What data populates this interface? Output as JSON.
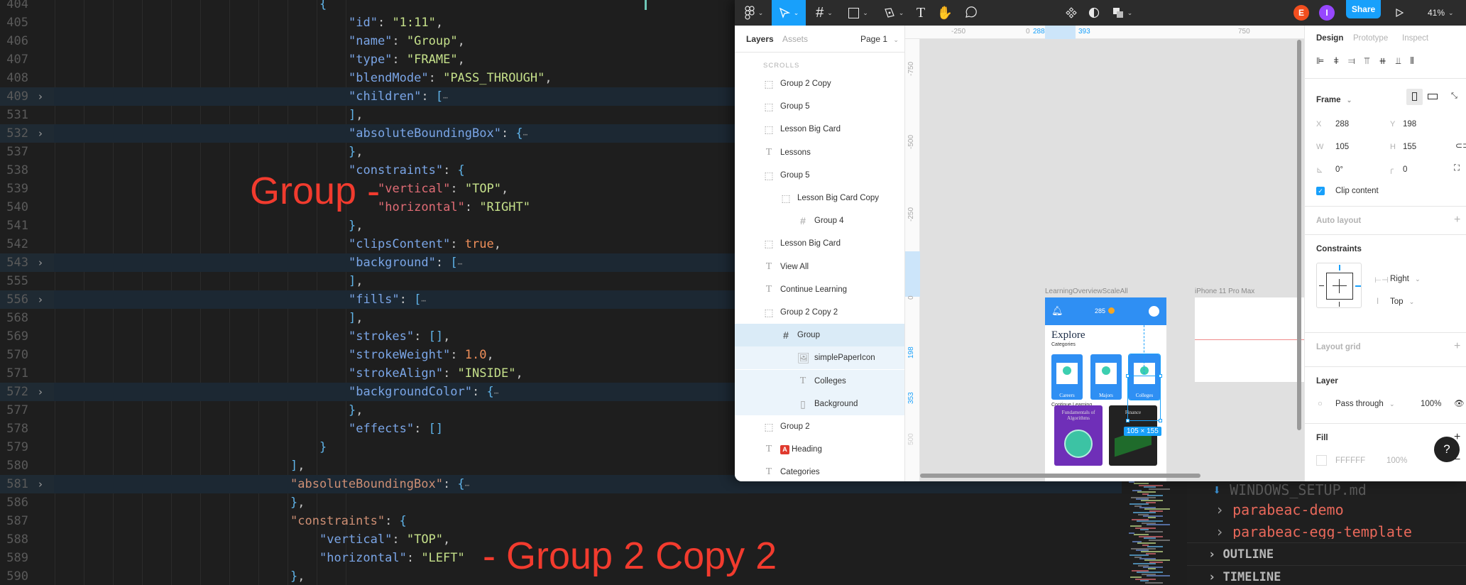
{
  "editor": {
    "lines": [
      {
        "n": "404",
        "fold": false,
        "hl": false,
        "indent": 0,
        "tokens": [
          [
            "b",
            "{"
          ]
        ]
      },
      {
        "n": "405",
        "fold": false,
        "hl": false,
        "indent": 1,
        "tokens": [
          [
            "k",
            "\"id\""
          ],
          [
            "p",
            ": "
          ],
          [
            "s",
            "\"1:11\""
          ],
          [
            "p",
            ","
          ]
        ]
      },
      {
        "n": "406",
        "fold": false,
        "hl": false,
        "indent": 1,
        "tokens": [
          [
            "k",
            "\"name\""
          ],
          [
            "p",
            ": "
          ],
          [
            "s",
            "\"Group\""
          ],
          [
            "p",
            ","
          ]
        ]
      },
      {
        "n": "407",
        "fold": false,
        "hl": false,
        "indent": 1,
        "tokens": [
          [
            "k",
            "\"type\""
          ],
          [
            "p",
            ": "
          ],
          [
            "s",
            "\"FRAME\""
          ],
          [
            "p",
            ","
          ]
        ]
      },
      {
        "n": "408",
        "fold": false,
        "hl": false,
        "indent": 1,
        "tokens": [
          [
            "k",
            "\"blendMode\""
          ],
          [
            "p",
            ": "
          ],
          [
            "s",
            "\"PASS_THROUGH\""
          ],
          [
            "p",
            ","
          ]
        ]
      },
      {
        "n": "409",
        "fold": true,
        "hl": true,
        "indent": 1,
        "tokens": [
          [
            "k",
            "\"children\""
          ],
          [
            "p",
            ": "
          ],
          [
            "b",
            "["
          ],
          [
            "ell",
            "⋯"
          ]
        ]
      },
      {
        "n": "531",
        "fold": false,
        "hl": false,
        "indent": 1,
        "tokens": [
          [
            "b",
            "]"
          ],
          [
            "p",
            ","
          ]
        ]
      },
      {
        "n": "532",
        "fold": true,
        "hl": true,
        "indent": 1,
        "tokens": [
          [
            "k",
            "\"absoluteBoundingBox\""
          ],
          [
            "p",
            ": "
          ],
          [
            "b",
            "{"
          ],
          [
            "ell",
            "⋯"
          ]
        ]
      },
      {
        "n": "537",
        "fold": false,
        "hl": false,
        "indent": 1,
        "tokens": [
          [
            "b",
            "}"
          ],
          [
            "p",
            ","
          ]
        ]
      },
      {
        "n": "538",
        "fold": false,
        "hl": false,
        "indent": 1,
        "tokens": [
          [
            "k",
            "\"constraints\""
          ],
          [
            "p",
            ": "
          ],
          [
            "b",
            "{"
          ]
        ]
      },
      {
        "n": "539",
        "fold": false,
        "hl": false,
        "indent": 2,
        "tokens": [
          [
            "kr",
            "\"vertical\""
          ],
          [
            "p",
            ": "
          ],
          [
            "s",
            "\"TOP\""
          ],
          [
            "p",
            ","
          ]
        ]
      },
      {
        "n": "540",
        "fold": false,
        "hl": false,
        "indent": 2,
        "tokens": [
          [
            "kr",
            "\"horizontal\""
          ],
          [
            "p",
            ": "
          ],
          [
            "s",
            "\"RIGHT\""
          ]
        ]
      },
      {
        "n": "541",
        "fold": false,
        "hl": false,
        "indent": 1,
        "tokens": [
          [
            "b",
            "}"
          ],
          [
            "p",
            ","
          ]
        ]
      },
      {
        "n": "542",
        "fold": false,
        "hl": false,
        "indent": 1,
        "tokens": [
          [
            "k",
            "\"clipsContent\""
          ],
          [
            "p",
            ": "
          ],
          [
            "n",
            "true"
          ],
          [
            "p",
            ","
          ]
        ]
      },
      {
        "n": "543",
        "fold": true,
        "hl": true,
        "indent": 1,
        "tokens": [
          [
            "k",
            "\"background\""
          ],
          [
            "p",
            ": "
          ],
          [
            "b",
            "["
          ],
          [
            "ell",
            "⋯"
          ]
        ]
      },
      {
        "n": "555",
        "fold": false,
        "hl": false,
        "indent": 1,
        "tokens": [
          [
            "b",
            "]"
          ],
          [
            "p",
            ","
          ]
        ]
      },
      {
        "n": "556",
        "fold": true,
        "hl": true,
        "indent": 1,
        "tokens": [
          [
            "k",
            "\"fills\""
          ],
          [
            "p",
            ": "
          ],
          [
            "b",
            "["
          ],
          [
            "ell",
            "⋯"
          ]
        ]
      },
      {
        "n": "568",
        "fold": false,
        "hl": false,
        "indent": 1,
        "tokens": [
          [
            "b",
            "]"
          ],
          [
            "p",
            ","
          ]
        ]
      },
      {
        "n": "569",
        "fold": false,
        "hl": false,
        "indent": 1,
        "tokens": [
          [
            "k",
            "\"strokes\""
          ],
          [
            "p",
            ": "
          ],
          [
            "b",
            "[]"
          ],
          [
            "p",
            ","
          ]
        ]
      },
      {
        "n": "570",
        "fold": false,
        "hl": false,
        "indent": 1,
        "tokens": [
          [
            "k",
            "\"strokeWeight\""
          ],
          [
            "p",
            ": "
          ],
          [
            "n",
            "1.0"
          ],
          [
            "p",
            ","
          ]
        ]
      },
      {
        "n": "571",
        "fold": false,
        "hl": false,
        "indent": 1,
        "tokens": [
          [
            "k",
            "\"strokeAlign\""
          ],
          [
            "p",
            ": "
          ],
          [
            "s",
            "\"INSIDE\""
          ],
          [
            "p",
            ","
          ]
        ]
      },
      {
        "n": "572",
        "fold": true,
        "hl": true,
        "indent": 1,
        "tokens": [
          [
            "k",
            "\"backgroundColor\""
          ],
          [
            "p",
            ": "
          ],
          [
            "b",
            "{"
          ],
          [
            "ell",
            "⋯"
          ]
        ]
      },
      {
        "n": "577",
        "fold": false,
        "hl": false,
        "indent": 1,
        "tokens": [
          [
            "b",
            "}"
          ],
          [
            "p",
            ","
          ]
        ]
      },
      {
        "n": "578",
        "fold": false,
        "hl": false,
        "indent": 1,
        "tokens": [
          [
            "k",
            "\"effects\""
          ],
          [
            "p",
            ": "
          ],
          [
            "b",
            "[]"
          ]
        ]
      },
      {
        "n": "579",
        "fold": false,
        "hl": false,
        "indent": 0,
        "tokens": [
          [
            "b",
            "}"
          ]
        ]
      },
      {
        "n": "580",
        "fold": false,
        "hl": false,
        "indent": -1,
        "tokens": [
          [
            "b",
            "]"
          ],
          [
            "p",
            ","
          ]
        ]
      },
      {
        "n": "581",
        "fold": true,
        "hl": true,
        "indent": -1,
        "tokens": [
          [
            "kb",
            "\"absoluteBoundingBox\""
          ],
          [
            "p",
            ": "
          ],
          [
            "b",
            "{"
          ],
          [
            "ell",
            "⋯"
          ]
        ]
      },
      {
        "n": "586",
        "fold": false,
        "hl": false,
        "indent": -1,
        "tokens": [
          [
            "b",
            "}"
          ],
          [
            "p",
            ","
          ]
        ]
      },
      {
        "n": "587",
        "fold": false,
        "hl": false,
        "indent": -1,
        "tokens": [
          [
            "kb",
            "\"constraints\""
          ],
          [
            "p",
            ": "
          ],
          [
            "b",
            "{"
          ]
        ]
      },
      {
        "n": "588",
        "fold": false,
        "hl": false,
        "indent": 0,
        "tokens": [
          [
            "k",
            "\"vertical\""
          ],
          [
            "p",
            ": "
          ],
          [
            "s",
            "\"TOP\""
          ],
          [
            "p",
            ","
          ]
        ]
      },
      {
        "n": "589",
        "fold": false,
        "hl": false,
        "indent": 0,
        "tokens": [
          [
            "k",
            "\"horizontal\""
          ],
          [
            "p",
            ": "
          ],
          [
            "s",
            "\"LEFT\""
          ]
        ]
      },
      {
        "n": "590",
        "fold": false,
        "hl": false,
        "indent": -1,
        "tokens": [
          [
            "b",
            "}"
          ],
          [
            "p",
            ","
          ]
        ]
      }
    ],
    "annotations": {
      "group": "Group -",
      "group2copy2": "- Group 2 Copy 2"
    }
  },
  "explorer": {
    "file": "WINDOWS_SETUP.md",
    "folders": [
      "parabeac-demo",
      "parabeac-egg-template"
    ],
    "sections": [
      "OUTLINE",
      "TIMELINE"
    ]
  },
  "figma": {
    "toolbar": {
      "avatars": [
        {
          "letter": "E",
          "color": "#f24e1e"
        },
        {
          "letter": "I",
          "color": "#9747ff"
        }
      ],
      "share_label": "Share",
      "zoom": "41%"
    },
    "layers_panel": {
      "tabs": [
        "Layers",
        "Assets"
      ],
      "page": "Page 1",
      "section": "SCROLLS",
      "items": [
        {
          "label": "Group 2 Copy",
          "icon": "group",
          "depth": 0,
          "state": ""
        },
        {
          "label": "Group 5",
          "icon": "group",
          "depth": 0,
          "state": ""
        },
        {
          "label": "Lesson Big Card",
          "icon": "group",
          "depth": 0,
          "state": ""
        },
        {
          "label": "Lessons",
          "icon": "text",
          "depth": 0,
          "state": ""
        },
        {
          "label": "Group 5",
          "icon": "group",
          "depth": 0,
          "state": ""
        },
        {
          "label": "Lesson Big Card Copy",
          "icon": "group",
          "depth": 1,
          "state": ""
        },
        {
          "label": "Group 4",
          "icon": "frame",
          "depth": 2,
          "state": ""
        },
        {
          "label": "Lesson Big Card",
          "icon": "group",
          "depth": 0,
          "state": ""
        },
        {
          "label": "View All",
          "icon": "text",
          "depth": 0,
          "state": ""
        },
        {
          "label": "Continue Learning",
          "icon": "text",
          "depth": 0,
          "state": ""
        },
        {
          "label": "Group 2 Copy 2",
          "icon": "group",
          "depth": 0,
          "state": ""
        },
        {
          "label": "Group",
          "icon": "frame",
          "depth": 1,
          "state": "selected"
        },
        {
          "label": "simplePaperIcon",
          "icon": "image",
          "depth": 2,
          "state": "child"
        },
        {
          "label": "Colleges",
          "icon": "text",
          "depth": 2,
          "state": "child"
        },
        {
          "label": "Background",
          "icon": "rect",
          "depth": 2,
          "state": "child"
        },
        {
          "label": "Group 2",
          "icon": "group",
          "depth": 0,
          "state": ""
        },
        {
          "label": "Heading",
          "icon": "text",
          "depth": 0,
          "state": "",
          "badge": "A"
        },
        {
          "label": "Categories",
          "icon": "text",
          "depth": 0,
          "state": ""
        }
      ]
    },
    "canvas": {
      "ruler_top": [
        "-250",
        "0",
        "288",
        "393",
        "750"
      ],
      "ruler_left": [
        "-750",
        "-500",
        "-250",
        "0",
        "198",
        "353",
        "500"
      ],
      "frame_label": "LearningOverviewScaleAll",
      "frame2_label": "iPhone 11 Pro Max",
      "phone": {
        "points": "285",
        "title": "Explore",
        "categories_label": "Categories",
        "cards": [
          "Careers",
          "Majors",
          "Colleges"
        ],
        "continue_label": "Continue Learning",
        "lessons": [
          {
            "title": "Fundamentals of Algorithms",
            "color": "#6f2fb8"
          },
          {
            "title": "Finance",
            "color": "#222222"
          }
        ]
      },
      "selection_size": "105 × 155"
    },
    "design_panel": {
      "tabs": [
        "Design",
        "Prototype",
        "Inspect"
      ],
      "frame_label": "Frame",
      "x": "288",
      "y": "198",
      "w": "105",
      "h": "155",
      "rotation": "0°",
      "radius": "0",
      "clip_content_label": "Clip content",
      "clip_content": true,
      "auto_layout_label": "Auto layout",
      "constraints_label": "Constraints",
      "constraint_h": "Right",
      "constraint_v": "Top",
      "layout_grid_label": "Layout grid",
      "layer_label": "Layer",
      "blend": "Pass through",
      "opacity": "100%",
      "fill_label": "Fill",
      "fill_hex": "FFFFFF",
      "fill_opacity": "100%",
      "help": "?"
    }
  }
}
